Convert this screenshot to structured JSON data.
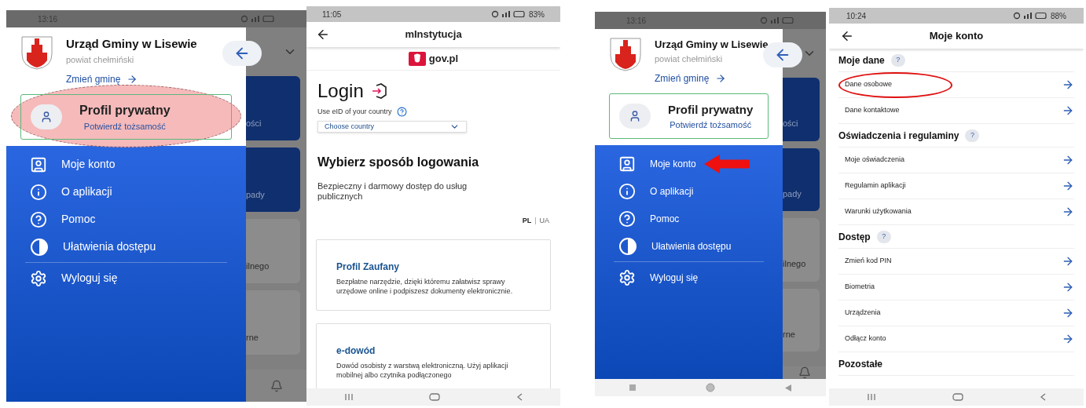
{
  "screens": [
    {
      "kind": "drawer",
      "status_time": "13:16",
      "municipality": "Urząd Gminy w Lisewie",
      "county": "powiat chełmiński",
      "change_link": "Zmień gminę",
      "profile": {
        "title": "Profil prywatny",
        "subtitle": "Potwierdź tożsamość",
        "highlighted": true
      },
      "menu": [
        {
          "label": "Moje konto",
          "pointed": false
        },
        {
          "label": "O aplikacji",
          "pointed": false
        },
        {
          "label": "Pomoc",
          "pointed": false
        },
        {
          "label": "Ułatwienia dostępu",
          "pointed": false
        },
        {
          "label": "Wyloguj się",
          "pointed": false
        }
      ],
      "background_tiles": [
        "ości",
        "pady",
        "ilnego",
        "rne"
      ]
    },
    {
      "kind": "login",
      "status_time": "11:05",
      "battery": "83%",
      "title": "mInstytucja",
      "brand": "gov.pl",
      "heading": "Login",
      "eid_label": "Use eID of your country",
      "country_select": {
        "placeholder": "Choose country"
      },
      "section_title": "Wybierz sposób logowania",
      "section_text": "Bezpieczny i darmowy dostęp do usług publicznych",
      "languages": [
        {
          "label": "PL",
          "selected": true
        },
        {
          "label": "UA",
          "selected": false
        }
      ],
      "language_separator": "|",
      "methods": [
        {
          "title": "Profil Zaufany",
          "text": "Bezpłatne narzędzie, dzięki któremu załatwisz sprawy urzędowe online i podpiszesz dokumenty elektronicznie."
        },
        {
          "title": "e-dowód",
          "text": "Dowód osobisty z warstwą elektroniczną. Użyj aplikacji mobilnej albo czytnika podłączonego"
        }
      ]
    },
    {
      "kind": "drawer",
      "status_time": "13:16",
      "municipality": "Urząd Gminy w Lisewie",
      "county": "powiat chełmiński",
      "change_link": "Zmień gminę",
      "profile": {
        "title": "Profil prywatny",
        "subtitle": "Potwierdź tożsamość",
        "highlighted": false
      },
      "menu": [
        {
          "label": "Moje konto",
          "pointed": true
        },
        {
          "label": "O aplikacji",
          "pointed": false
        },
        {
          "label": "Pomoc",
          "pointed": false
        },
        {
          "label": "Ułatwienia dostępu",
          "pointed": false
        },
        {
          "label": "Wyloguj się",
          "pointed": false
        }
      ],
      "background_tiles": [
        "ości",
        "pady",
        "ilnego",
        "rne"
      ]
    },
    {
      "kind": "account",
      "status_time": "10:24",
      "battery": "88%",
      "title": "Moje konto",
      "sections": [
        {
          "title": "Moje dane",
          "help_badge": "?",
          "rows": [
            {
              "label": "Dane osobowe",
              "circled": true
            },
            {
              "label": "Dane kontaktowe",
              "circled": false
            }
          ]
        },
        {
          "title": "Oświadczenia i regulaminy",
          "help_badge": "?",
          "rows": [
            {
              "label": "Moje oświadczenia",
              "circled": false
            },
            {
              "label": "Regulamin aplikacji",
              "circled": false
            },
            {
              "label": "Warunki użytkowania",
              "circled": false
            }
          ]
        },
        {
          "title": "Dostęp",
          "help_badge": "?",
          "rows": [
            {
              "label": "Zmień kod PIN",
              "circled": false
            },
            {
              "label": "Biometria",
              "circled": false
            },
            {
              "label": "Urządzenia",
              "circled": false
            },
            {
              "label": "Odłącz konto",
              "circled": false
            }
          ]
        },
        {
          "title": "Pozostałe"
        }
      ]
    }
  ]
}
